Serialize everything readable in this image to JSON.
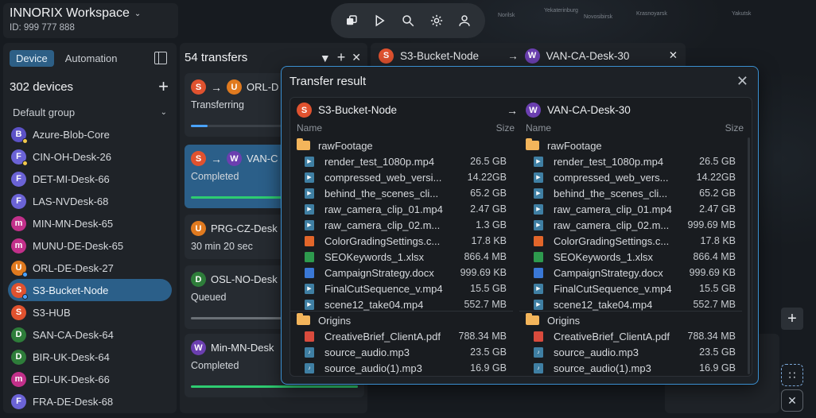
{
  "map": {
    "labels": [
      "Norilsk",
      "Yekaterinburg",
      "Novosibirsk",
      "Krasnoyarsk",
      "Yakutsk"
    ]
  },
  "workspace": {
    "title": "INNORIX Workspace",
    "id": "ID: 999 777 888"
  },
  "device_panel": {
    "tabs": [
      "Device",
      "Automation"
    ],
    "count": "302  devices",
    "group": "Default group",
    "devices": [
      {
        "letter": "B",
        "name": "Azure-Blob-Core",
        "color": "#5c52c7",
        "dot": "#f2c94c"
      },
      {
        "letter": "F",
        "name": "CIN-OH-Desk-26",
        "color": "#6b63d6",
        "dot": "#f2c94c"
      },
      {
        "letter": "F",
        "name": "DET-MI-Desk-66",
        "color": "#6b63d6",
        "dot": ""
      },
      {
        "letter": "F",
        "name": "LAS-NVDesk-68",
        "color": "#6b63d6",
        "dot": ""
      },
      {
        "letter": "m",
        "name": "MIN-MN-Desk-65",
        "color": "#c2308a",
        "dot": ""
      },
      {
        "letter": "m",
        "name": "MUNU-DE-Desk-65",
        "color": "#c2308a",
        "dot": ""
      },
      {
        "letter": "U",
        "name": "ORL-DE-Desk-27",
        "color": "#e07a1f",
        "dot": "#4aa3ff"
      },
      {
        "letter": "S",
        "name": "S3-Bucket-Node",
        "color": "#e0522f",
        "dot": "#4aa3ff"
      },
      {
        "letter": "S",
        "name": "S3-HUB",
        "color": "#e0522f",
        "dot": ""
      },
      {
        "letter": "D",
        "name": "SAN-CA-Desk-64",
        "color": "#2e7d3a",
        "dot": ""
      },
      {
        "letter": "D",
        "name": "BIR-UK-Desk-64",
        "color": "#2e7d3a",
        "dot": ""
      },
      {
        "letter": "m",
        "name": "EDI-UK-Desk-66",
        "color": "#c2308a",
        "dot": ""
      },
      {
        "letter": "F",
        "name": "FRA-DE-Desk-68",
        "color": "#6b63d6",
        "dot": ""
      }
    ],
    "selected_index": 7
  },
  "transfers_panel": {
    "count": "54  transfers",
    "cards": [
      {
        "src": "S",
        "src_color": "#e0522f",
        "dst": "U",
        "dst_color": "#e07a1f",
        "dst_name": "ORL-D",
        "status": "Transferring",
        "progress": 0.1,
        "bar_color": "#4aa3ff"
      },
      {
        "src": "S",
        "src_color": "#e0522f",
        "dst": "W",
        "dst_color": "#6b3fb0",
        "dst_name": "VAN-C",
        "status": "Completed",
        "progress": 1.0,
        "bar_color": "#2ecc71"
      },
      {
        "src": "",
        "src_color": "",
        "dst": "U",
        "dst_color": "#e07a1f",
        "dst_name": "PRG-CZ-Desk",
        "status": "30 min 20 sec",
        "progress": 0,
        "bar_color": ""
      },
      {
        "src": "",
        "src_color": "",
        "dst": "D",
        "dst_color": "#2e7d3a",
        "dst_name": "OSL-NO-Desk",
        "status": "Queued",
        "progress": 0,
        "bar_color": "#8a9096"
      },
      {
        "src": "",
        "src_color": "",
        "dst": "W",
        "dst_color": "#6b3fb0",
        "dst_name": "Min-MN-Desk",
        "status": "Completed",
        "progress": 1.0,
        "bar_color": "#2ecc71"
      }
    ]
  },
  "pair_strip": {
    "src_letter": "S",
    "src_name": "S3-Bucket-Node",
    "dst_letter": "W",
    "dst_name": "VAN-CA-Desk-30"
  },
  "dialog": {
    "title": "Transfer result",
    "left": {
      "letter": "S",
      "device": "S3-Bucket-Node",
      "name_label": "Name",
      "size_label": "Size"
    },
    "right": {
      "letter": "W",
      "device": "VAN-CA-Desk-30",
      "name_label": "Name",
      "size_label": "Size"
    },
    "left_rows": [
      {
        "type": "folder",
        "name": "rawFootage",
        "size": ""
      },
      {
        "type": "video",
        "name": "render_test_1080p.mp4",
        "size": "26.5 GB"
      },
      {
        "type": "video",
        "name": "compressed_web_versi...",
        "size": "14.22GB"
      },
      {
        "type": "video",
        "name": "behind_the_scenes_cli...",
        "size": "65.2 GB"
      },
      {
        "type": "video",
        "name": "raw_camera_clip_01.mp4",
        "size": "2.47 GB"
      },
      {
        "type": "video",
        "name": "raw_camera_clip_02.m...",
        "size": "1.3 GB"
      },
      {
        "type": "settings",
        "name": "ColorGradingSettings.c...",
        "size": "17.8 KB"
      },
      {
        "type": "sheet",
        "name": "SEOKeywords_1.xlsx",
        "size": "866.4 MB"
      },
      {
        "type": "doc",
        "name": "CampaignStrategy.docx",
        "size": "999.69 KB"
      },
      {
        "type": "video",
        "name": "FinalCutSequence_v.mp4",
        "size": "15.5 GB"
      },
      {
        "type": "video",
        "name": "scene12_take04.mp4",
        "size": "552.7 MB"
      },
      {
        "type": "folder",
        "name": "Origins",
        "size": ""
      },
      {
        "type": "pdf",
        "name": "CreativeBrief_ClientA.pdf",
        "size": "788.34 MB"
      },
      {
        "type": "audio",
        "name": "source_audio.mp3",
        "size": "23.5 GB"
      },
      {
        "type": "audio",
        "name": "source_audio(1).mp3",
        "size": "16.9 GB"
      }
    ],
    "right_rows": [
      {
        "type": "folder",
        "name": "rawFootage",
        "size": ""
      },
      {
        "type": "video",
        "name": "render_test_1080p.mp4",
        "size": "26.5 GB"
      },
      {
        "type": "video",
        "name": "compressed_web_vers...",
        "size": "14.22GB"
      },
      {
        "type": "video",
        "name": "behind_the_scenes_cli...",
        "size": "65.2 GB"
      },
      {
        "type": "video",
        "name": "raw_camera_clip_01.mp4",
        "size": "2.47 GB"
      },
      {
        "type": "video",
        "name": "raw_camera_clip_02.m...",
        "size": "999.69 MB"
      },
      {
        "type": "settings",
        "name": "ColorGradingSettings.c...",
        "size": "17.8 KB"
      },
      {
        "type": "sheet",
        "name": "SEOKeywords_1.xlsx",
        "size": "866.4 MB"
      },
      {
        "type": "doc",
        "name": "CampaignStrategy.docx",
        "size": "999.69 KB"
      },
      {
        "type": "video",
        "name": "FinalCutSequence_v.mp4",
        "size": "15.5 GB"
      },
      {
        "type": "video",
        "name": "scene12_take04.mp4",
        "size": "552.7 MB"
      },
      {
        "type": "folder",
        "name": "Origins",
        "size": ""
      },
      {
        "type": "pdf",
        "name": "CreativeBrief_ClientA.pdf",
        "size": "788.34 MB"
      },
      {
        "type": "audio",
        "name": "source_audio.mp3",
        "size": "23.5 GB"
      },
      {
        "type": "audio",
        "name": "source_audio(1).mp3",
        "size": "16.9 GB"
      }
    ]
  },
  "icons": {
    "toolbar": [
      "screen-share-icon",
      "play-icon",
      "search-icon",
      "gear-icon",
      "user-icon"
    ]
  }
}
